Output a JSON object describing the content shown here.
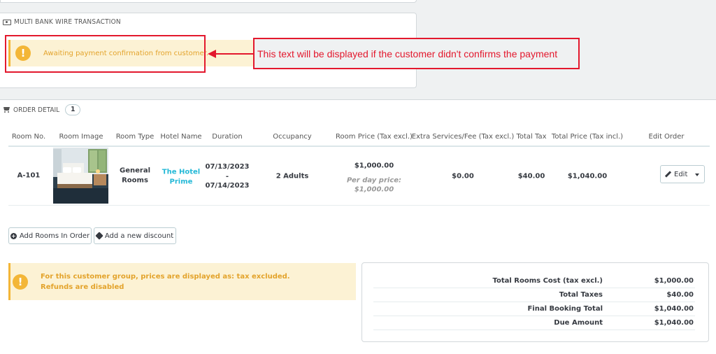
{
  "payment": {
    "heading": "Multi Bank Wire Transaction",
    "alert_icon": "exclamation-icon",
    "alert_text": "Awaiting payment confirmation from customer.",
    "annotation": "This text will be displayed if the customer didn't confirms the payment"
  },
  "order": {
    "heading": "Order Detail",
    "count": "1",
    "columns": [
      "Room No.",
      "Room Image",
      "Room Type",
      "Hotel Name",
      "Duration",
      "Occupancy",
      "Room Price (Tax excl.)",
      "Extra Services/Fee (Tax excl.)",
      "Total Tax",
      "Total Price (Tax incl.)",
      "Edit Order"
    ],
    "row": {
      "room_no": "A-101",
      "room_type_1": "General",
      "room_type_2": "Rooms",
      "hotel_1": "The Hotel",
      "hotel_2": "Prime",
      "date_from": "07/13/2023",
      "date_sep": "-",
      "date_to": "07/14/2023",
      "occupancy": "2 Adults",
      "room_price": "$1,000.00",
      "per_day_label": "Per day price:",
      "per_day_value": "$1,000.00",
      "extra_fee": "$0.00",
      "total_tax": "$40.00",
      "total_price": "$1,040.00",
      "edit_label": "Edit"
    },
    "add_rooms_label": "Add Rooms In Order",
    "add_discount_label": "Add a new discount"
  },
  "tax_notice": {
    "line1": "For this customer group, prices are displayed as: tax excluded.",
    "line2": "Refunds are disabled"
  },
  "totals": [
    {
      "label": "Total Rooms Cost (tax excl.)",
      "value": "$1,000.00"
    },
    {
      "label": "Total Taxes",
      "value": "$40.00"
    },
    {
      "label": "Final Booking Total",
      "value": "$1,040.00"
    },
    {
      "label": "Due Amount",
      "value": "$1,040.00"
    }
  ],
  "colors": {
    "accent": "#25b9d7",
    "warning_bg": "#fcf2d4",
    "warning_text": "#e3a32b",
    "annotation_red": "#e3182d"
  }
}
